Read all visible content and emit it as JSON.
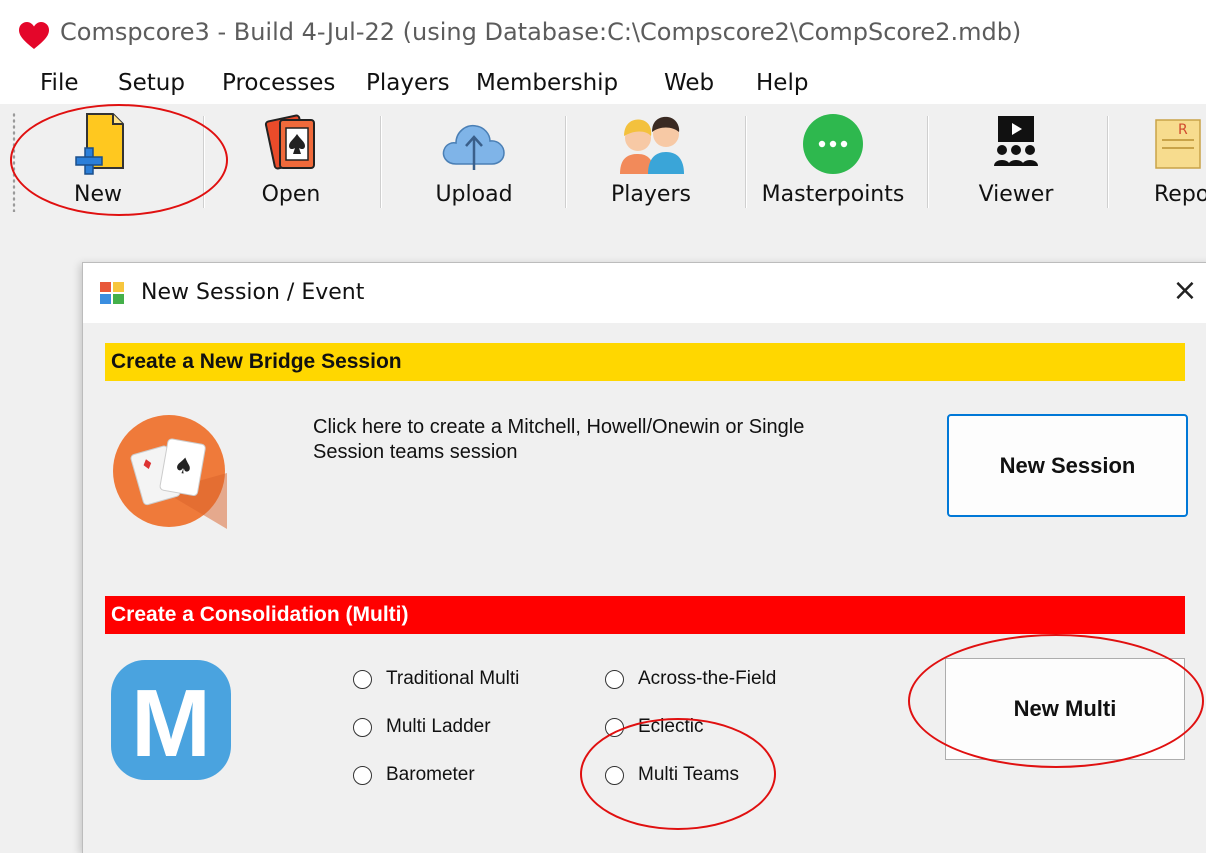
{
  "window": {
    "title": "Comspcore3 - Build 4-Jul-22 (using Database:C:\\Compscore2\\CompScore2.mdb)",
    "icon": "heart-icon"
  },
  "menu": [
    "File",
    "Setup",
    "Processes",
    "Players",
    "Membership",
    "Web",
    "Help"
  ],
  "toolbar": {
    "items": [
      {
        "label": "New",
        "icon": "new-document-icon"
      },
      {
        "label": "Open",
        "icon": "playing-card-icon"
      },
      {
        "label": "Upload",
        "icon": "cloud-upload-icon"
      },
      {
        "label": "Players",
        "icon": "players-icon"
      },
      {
        "label": "Masterpoints",
        "icon": "more-dots-icon"
      },
      {
        "label": "Viewer",
        "icon": "viewer-icon"
      },
      {
        "label": "Repo",
        "icon": "report-icon"
      }
    ]
  },
  "dialog": {
    "title": "New Session / Event",
    "close": "×",
    "session": {
      "heading": "Create a New Bridge Session",
      "description": "Click here to create a Mitchell, Howell/Onewin or Single Session teams session",
      "button": "New Session",
      "icon": "cards-icon"
    },
    "multi": {
      "heading": "Create a Consolidation (Multi)",
      "icon": "m-letter-icon",
      "options": [
        "Traditional Multi",
        "Across-the-Field",
        "Multi Ladder",
        "Eclectic",
        "Barometer",
        "Multi Teams"
      ],
      "button": "New Multi"
    }
  },
  "colors": {
    "yellow_band": "#ffd700",
    "red_band": "#ff0000",
    "annotation": "#e01010",
    "accent_blue": "#0078d7"
  }
}
